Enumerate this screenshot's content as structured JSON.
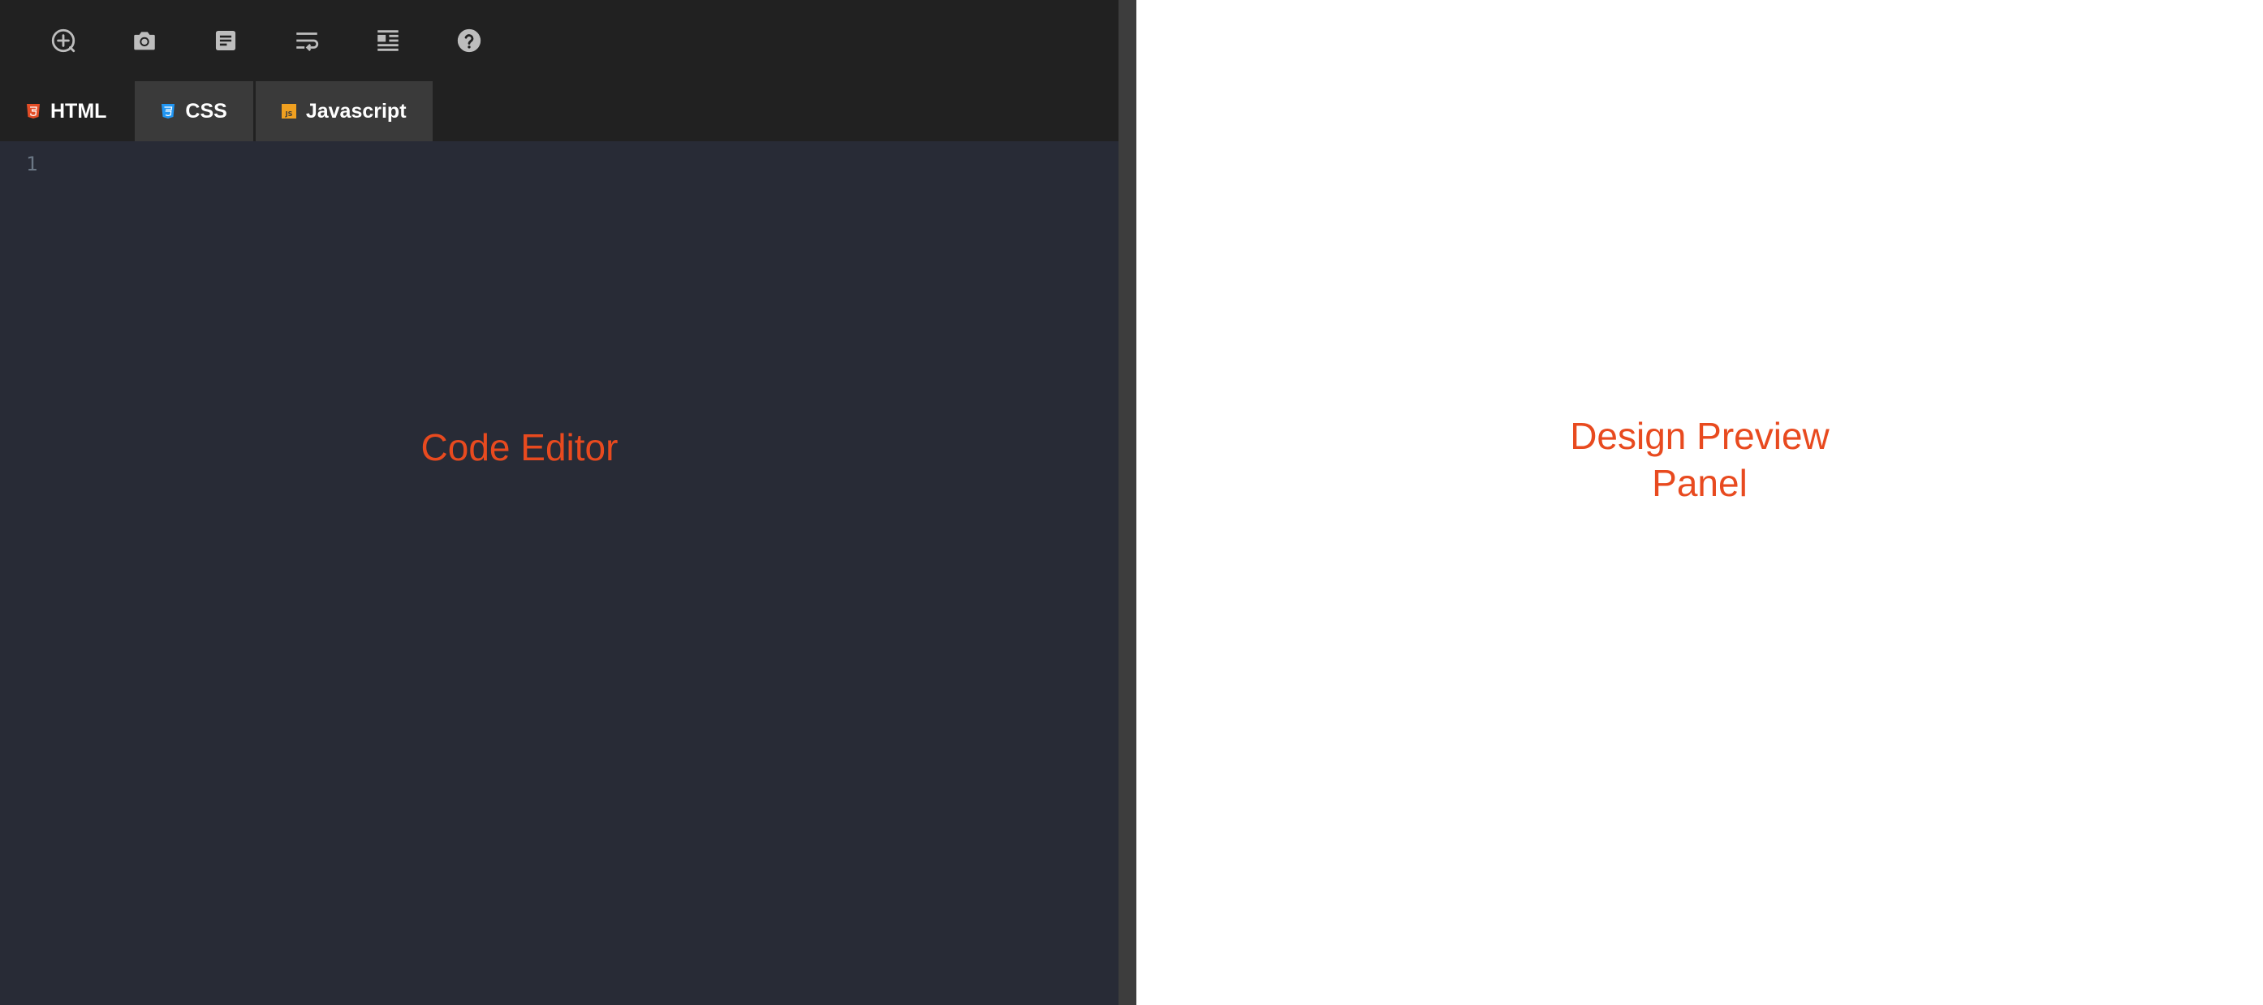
{
  "toolbar": {
    "buttons": [
      {
        "icon": "add-circle-icon"
      },
      {
        "icon": "camera-icon"
      },
      {
        "icon": "document-icon"
      },
      {
        "icon": "wrap-text-icon"
      },
      {
        "icon": "format-align-icon"
      },
      {
        "icon": "help-icon"
      }
    ]
  },
  "tabs": [
    {
      "label": "HTML",
      "icon": "html5-icon",
      "icon_color": "#e44d26"
    },
    {
      "label": "CSS",
      "icon": "css3-icon",
      "icon_color": "#2196f3"
    },
    {
      "label": "Javascript",
      "icon": "js-icon",
      "icon_color": "#f0a020"
    }
  ],
  "editor": {
    "line_number": "1",
    "label": "Code Editor"
  },
  "preview": {
    "label_line1": "Design Preview",
    "label_line2": "Panel"
  },
  "colors": {
    "accent": "#e84a1f",
    "toolbar_bg": "#212121",
    "editor_bg": "#282b36",
    "tab_inactive_bg": "#3a3a3a"
  }
}
